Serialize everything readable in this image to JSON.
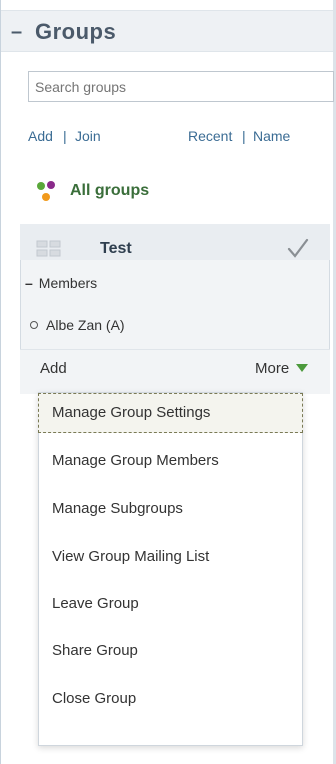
{
  "panel": {
    "collapse_symbol": "–",
    "title": "Groups"
  },
  "search": {
    "placeholder": "Search groups"
  },
  "actions": {
    "add": "Add",
    "sep1": "|",
    "join": "Join",
    "recent": "Recent",
    "sep2": "|",
    "name": "Name"
  },
  "all_groups": {
    "label": "All groups",
    "icon": "all-groups-dots-icon"
  },
  "group": {
    "name": "Test",
    "icon": "group-icon",
    "check_icon": "checkmark-icon",
    "members_toggle_symbol": "–",
    "members_label": "Members",
    "members": [
      "Albe Zan (A)"
    ],
    "add_label": "Add",
    "more_label": "More"
  },
  "menu": {
    "items": [
      "Manage Group Settings",
      "Manage Group Members",
      "Manage Subgroups",
      "View Group Mailing List",
      "Leave Group",
      "Share Group",
      "Close Group"
    ]
  },
  "colors": {
    "link": "#3b6c94",
    "all_groups": "#3a6e3a",
    "more_arrow": "#4c9a3c",
    "header_bg": "#eef1f4"
  }
}
